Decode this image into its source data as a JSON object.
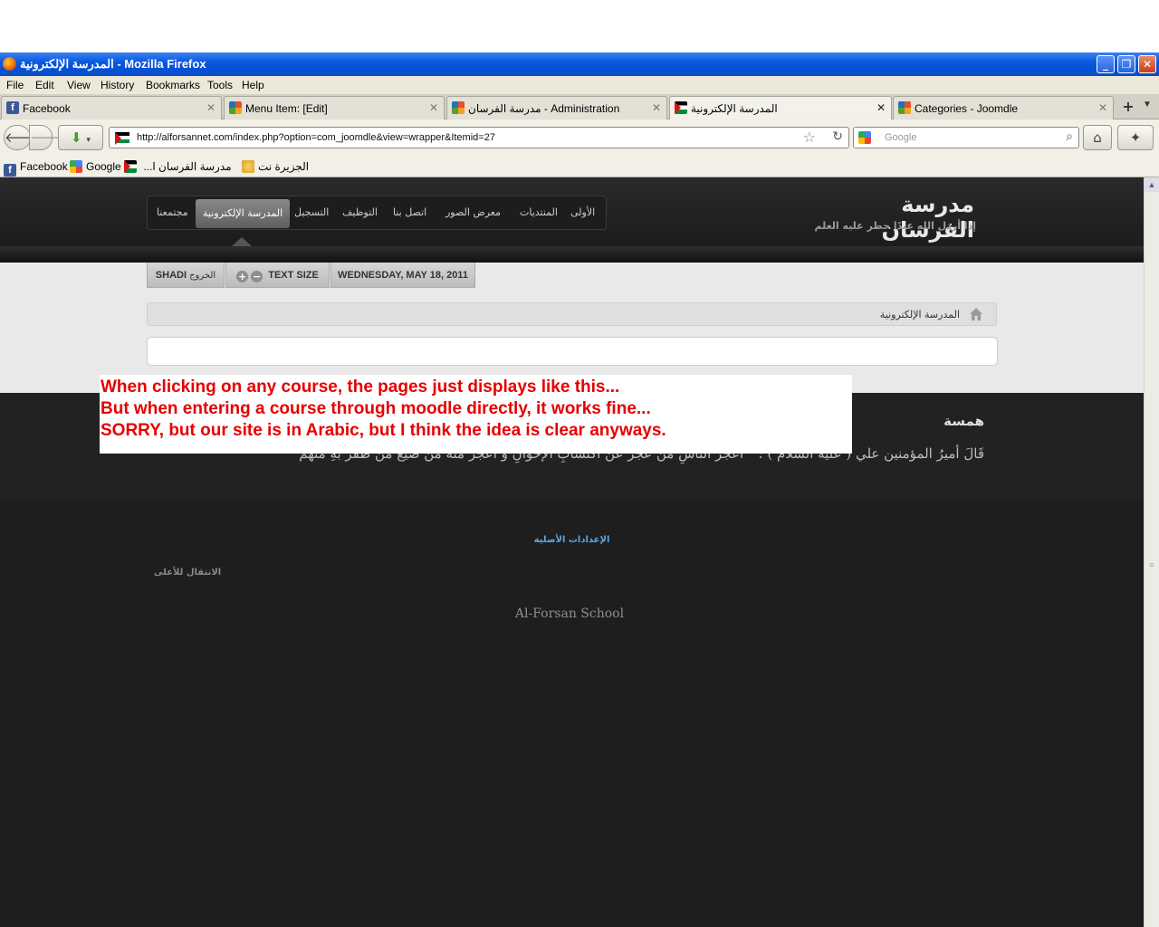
{
  "window": {
    "title": "المدرسة الإلكترونية - Mozilla Firefox",
    "controls": {
      "minimize": "_",
      "maximize": "❐",
      "close": "✕"
    }
  },
  "menubar": [
    "File",
    "Edit",
    "View",
    "History",
    "Bookmarks",
    "Tools",
    "Help"
  ],
  "tabs": [
    {
      "label": "Facebook",
      "icon": "facebook-icon",
      "active": false
    },
    {
      "label": "Menu Item: [Edit]",
      "icon": "joomla-icon",
      "active": false
    },
    {
      "label": "مدرسة الفرسان - Administration",
      "icon": "joomla-icon",
      "active": false
    },
    {
      "label": "المدرسة الإلكترونية",
      "icon": "flag-icon",
      "active": true
    },
    {
      "label": "Categories - Joomdle",
      "icon": "joomla-icon",
      "active": false
    }
  ],
  "navbar": {
    "url": "http://alforsannet.com/index.php?option=com_joomdle&view=wrapper&Itemid=27",
    "search_placeholder": "Google"
  },
  "bookmarks": [
    {
      "label": "Facebook",
      "icon": "facebook-icon"
    },
    {
      "label": "Google",
      "icon": "google-icon"
    },
    {
      "label": "...مدرسة الفرسان ا",
      "icon": "flag-icon"
    },
    {
      "label": "الجزيرة نت",
      "icon": "aljazeera-icon"
    }
  ],
  "site": {
    "logo_title": "مدرسة الفرسان",
    "logo_tagline": "إذا أرذل الله عبدًا حظر عليه العلم",
    "menu": [
      "الأولى",
      "المنتديات",
      "معرض الصور",
      "اتصل بنا",
      "التوظيف",
      "التسجيل",
      "المدرسة الإلكترونية",
      "مجتمعنا"
    ],
    "toolbar": {
      "user": "SHADI",
      "logout": "الخروج",
      "text_size": "TEXT SIZE",
      "date": "WEDNESDAY, MAY 18, 2011"
    },
    "breadcrumb": "المدرسة الإلكترونية",
    "quote_title": "همسة",
    "quote_text": "قَالَ أميرُ المؤمنين علي ( عليه السلام ) : \" أعجزُ الناسِ من عجزَ عنْ اكتسابِ الإخوانِ و أعجزُ منه من ضيعَ من ظفرَ بهِ منهم",
    "footer_link": "الإعدادات الأصلية",
    "to_top": "الانتقال للأعلى",
    "copyright": "Al-Forsan School"
  },
  "note": [
    "When clicking on any course, the pages just displays like this...",
    "But when entering a course through moodle directly, it works fine...",
    "SORRY, but our site is in Arabic, but I think the idea is clear anyways."
  ]
}
